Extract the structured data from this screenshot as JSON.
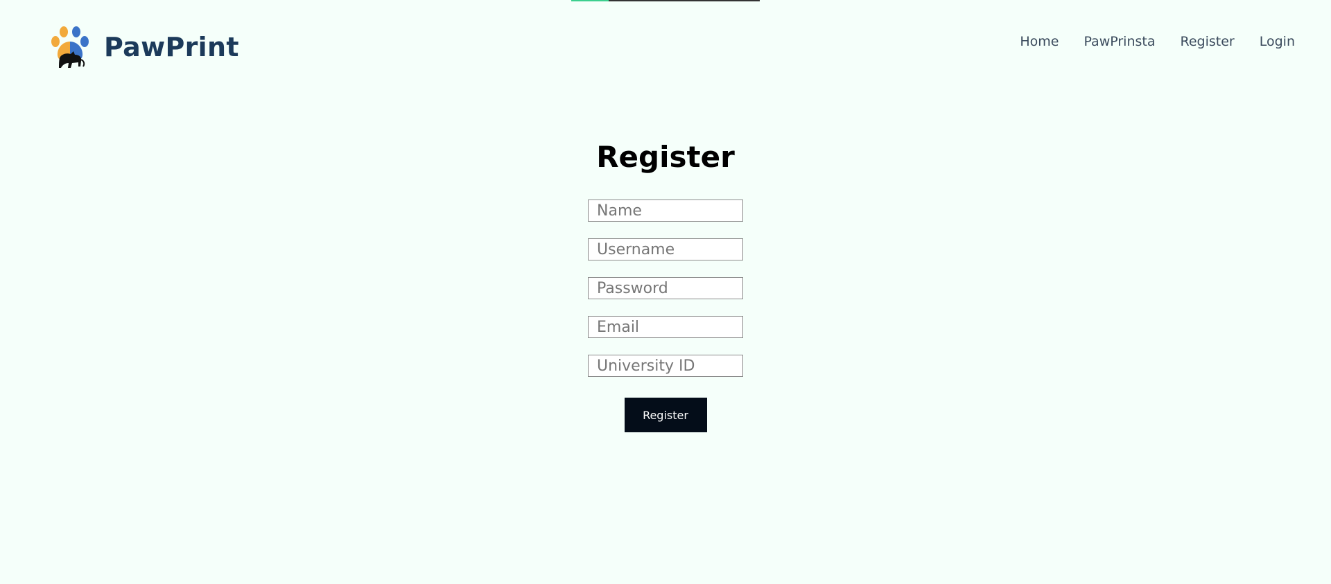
{
  "progress": {
    "fraction": 0.2,
    "fill_color": "#3ccf8e",
    "track_color": "#333333"
  },
  "header": {
    "brand_name": "PawPrint",
    "logo_icon": "paw-print-cat-icon",
    "brand_color": "#1c3a5a",
    "nav": [
      {
        "label": "Home"
      },
      {
        "label": "PawPrinsta"
      },
      {
        "label": "Register"
      },
      {
        "label": "Login"
      }
    ]
  },
  "form": {
    "title": "Register",
    "fields": [
      {
        "name": "name",
        "placeholder": "Name",
        "value": ""
      },
      {
        "name": "username",
        "placeholder": "Username",
        "value": ""
      },
      {
        "name": "password",
        "placeholder": "Password",
        "value": ""
      },
      {
        "name": "email",
        "placeholder": "Email",
        "value": ""
      },
      {
        "name": "university_id",
        "placeholder": "University ID",
        "value": ""
      }
    ],
    "submit_label": "Register",
    "button_color": "#040d19"
  },
  "colors": {
    "background": "#f5fffa"
  }
}
